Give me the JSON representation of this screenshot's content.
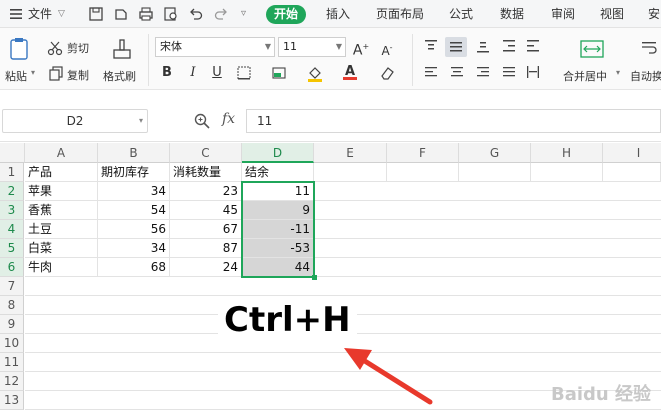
{
  "menubar": {
    "file_label": "文件",
    "tabs": [
      {
        "label": "开始",
        "active": true
      },
      {
        "label": "插入"
      },
      {
        "label": "页面布局"
      },
      {
        "label": "公式"
      },
      {
        "label": "数据"
      },
      {
        "label": "审阅"
      },
      {
        "label": "视图"
      },
      {
        "label": "安"
      }
    ]
  },
  "ribbon": {
    "paste_label": "粘贴",
    "cut_label": "剪切",
    "copy_label": "复制",
    "format_painter_label": "格式刷",
    "font_name": "宋体",
    "font_size": "11",
    "merge_center_label": "合并居中",
    "auto_wrap_label": "自动换"
  },
  "formula_bar": {
    "name_box": "D2",
    "fx_symbol": "fx",
    "value": "11"
  },
  "sheet": {
    "columns": [
      "A",
      "B",
      "C",
      "D",
      "E",
      "F",
      "G",
      "H",
      "I"
    ],
    "rows": [
      "1",
      "2",
      "3",
      "4",
      "5",
      "6",
      "7",
      "8",
      "9",
      "10",
      "11",
      "12",
      "13"
    ],
    "headers": [
      "产品",
      "期初库存",
      "消耗数量",
      "结余"
    ],
    "data": [
      [
        "苹果",
        "34",
        "23",
        "11"
      ],
      [
        "香蕉",
        "54",
        "45",
        "9"
      ],
      [
        "土豆",
        "56",
        "67",
        "-11"
      ],
      [
        "白菜",
        "34",
        "87",
        "-53"
      ],
      [
        "牛肉",
        "68",
        "24",
        "44"
      ]
    ]
  },
  "annotation": {
    "shortcut": "Ctrl+H"
  },
  "watermark": "Baidu 经验",
  "colors": {
    "accent": "#1fa65a",
    "selection_fill": "#d6d6d6",
    "arrow": "#e8392c"
  }
}
